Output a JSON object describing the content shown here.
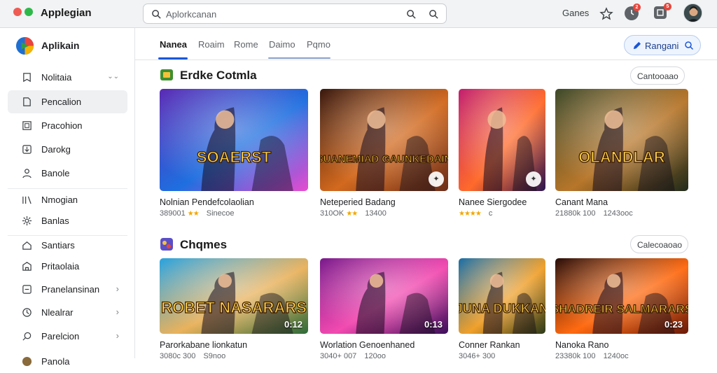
{
  "window": {
    "title": "Applegian"
  },
  "search": {
    "placeholder": "Aplorkcanan"
  },
  "header": {
    "right_label": "Ganes",
    "badges": [
      "2",
      "5"
    ]
  },
  "sidebar": {
    "brand": "Aplikain",
    "items": [
      {
        "label": "Nolitaia",
        "icon": "bookmark-icon",
        "suffix": "⌄⌄"
      },
      {
        "label": "Pencalion",
        "icon": "file-icon"
      },
      {
        "label": "Pracohion",
        "icon": "square-icon"
      },
      {
        "label": "Darokg",
        "icon": "download-icon"
      },
      {
        "label": "Banole",
        "icon": "user-icon"
      },
      {
        "label": "Nmogian",
        "icon": "library-icon"
      },
      {
        "label": "Banlas",
        "icon": "gear-icon"
      },
      {
        "label": "Santiars",
        "icon": "home-icon"
      },
      {
        "label": "Pritaolaia",
        "icon": "store-icon"
      },
      {
        "label": "Pranelansinan",
        "icon": "box-icon",
        "chevron": "›"
      },
      {
        "label": "Nlealrar",
        "icon": "clock-icon",
        "chevron": "›"
      },
      {
        "label": "Parelcion",
        "icon": "search-icon",
        "chevron": "›"
      },
      {
        "label": "Panola",
        "icon": "avatar-icon"
      }
    ]
  },
  "tabs": [
    "Nanea",
    "Roaim",
    "Rome",
    "Daimo",
    "Pqmo"
  ],
  "range_button": {
    "label": "Rangani"
  },
  "sections": [
    {
      "title": "Erdke Cotmla",
      "pill": "Cantooaao",
      "cards": [
        {
          "title": "Nolnian Pendefcolaolian",
          "meta": "389001",
          "stars": "★★",
          "extra": "Sinecoe"
        },
        {
          "title": "Neteperied Badang",
          "meta": "310OK",
          "stars": "★★",
          "extra": "13400"
        },
        {
          "title": "Nanee Siergodee",
          "meta": "",
          "stars": "★★★★",
          "extra": "c"
        },
        {
          "title": "Canant Mana",
          "meta": "21880k 100",
          "stars": "",
          "extra": "1243ooc"
        }
      ]
    },
    {
      "title": "Chqmes",
      "pill": "Calecoaoao",
      "cards": [
        {
          "title": "Parorkabane lionkatun",
          "meta": "3080c 300",
          "stars": "",
          "extra": "S9noo",
          "overlay": "0:12"
        },
        {
          "title": "Worlation Genoenhaned",
          "meta": "3040+ 007",
          "stars": "",
          "extra": "120oo",
          "overlay": "0:13"
        },
        {
          "title": "Conner Rankan",
          "meta": "3046+ 300",
          "stars": "",
          "extra": ""
        },
        {
          "title": "Nanoka Rano",
          "meta": "23380k 100",
          "stars": "",
          "extra": "1240oc",
          "overlay": "0:23"
        }
      ]
    }
  ],
  "game_art": [
    {
      "logo": "SOAERST",
      "colors": [
        "#5b2bb5",
        "#1e6fe0",
        "#e84cd0"
      ]
    },
    {
      "logo": "SUANEMIAD GAUNKEDAIN",
      "colors": [
        "#3a1a10",
        "#d2691e",
        "#6b2d1a"
      ]
    },
    {
      "logo": "",
      "colors": [
        "#c2206f",
        "#ff6a2a",
        "#2a1650"
      ]
    },
    {
      "logo": "OLANDLAR",
      "colors": [
        "#3e4a2a",
        "#b7762a",
        "#1f2a1a"
      ]
    },
    {
      "logo": "ROBET NASARARS",
      "colors": [
        "#2aa3e0",
        "#e9b25c",
        "#2d6b3a"
      ]
    },
    {
      "logo": "",
      "colors": [
        "#7a1b8c",
        "#f24ab0",
        "#3a0f5a"
      ]
    },
    {
      "logo": "JUNA DUKKAN",
      "colors": [
        "#1a6fa8",
        "#f0a02a",
        "#2a3a1a"
      ]
    },
    {
      "logo": "SHADREIR SALMARARS",
      "colors": [
        "#2a0f0a",
        "#ff6a10",
        "#6a1a0a"
      ]
    }
  ]
}
